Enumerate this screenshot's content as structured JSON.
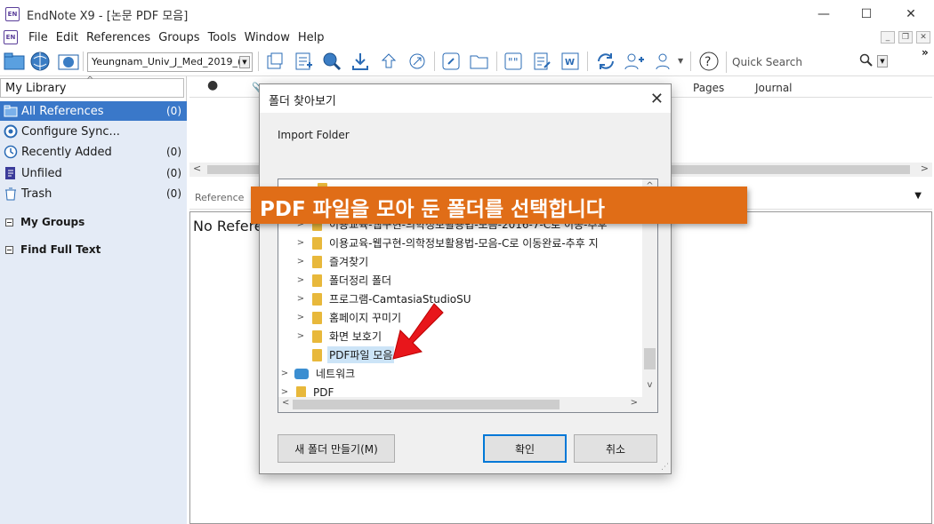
{
  "window": {
    "title": "EndNote X9 - [논문 PDF 모음]",
    "app_icon_text": "EN",
    "minimize": "—",
    "maximize": "☐",
    "close": "✕"
  },
  "menu": [
    "File",
    "Edit",
    "References",
    "Groups",
    "Tools",
    "Window",
    "Help"
  ],
  "toolbar": {
    "style_value": "Yeungnam_Univ_J_Med_2019_(",
    "quick_search_placeholder": "Quick Search"
  },
  "library": {
    "header": "My Library",
    "items": [
      {
        "label": "All References",
        "count": "(0)"
      },
      {
        "label": "Configure Sync...",
        "count": ""
      },
      {
        "label": "Recently Added",
        "count": "(0)"
      },
      {
        "label": "Unfiled",
        "count": "(0)"
      },
      {
        "label": "Trash",
        "count": "(0)"
      }
    ],
    "groups": [
      "My Groups",
      "Find Full Text"
    ]
  },
  "list_columns": {
    "pages": "Pages",
    "journal": "Journal"
  },
  "ref_tab": "Reference",
  "preview_text": "No Refere",
  "dialog": {
    "title": "폴더 찾아보기",
    "description": "Import Folder",
    "tree": [
      {
        "label": "이용교육-웹구현-의학정보활용법-모음-2016-7-C로 이동-추후",
        "type": "folder"
      },
      {
        "label": "이용교육-웹구현-의학정보활용법-모음-C로 이동완료-추후 지",
        "type": "folder"
      },
      {
        "label": "즐겨찾기",
        "type": "folder"
      },
      {
        "label": "폴더정리 폴더",
        "type": "folder"
      },
      {
        "label": "프로그램-CamtasiaStudioSU",
        "type": "folder"
      },
      {
        "label": "홈페이지 꾸미기",
        "type": "folder"
      },
      {
        "label": "화면 보호기",
        "type": "folder"
      },
      {
        "label": "PDF파일 모음",
        "type": "folder-selected"
      },
      {
        "label": "네트워크",
        "type": "network"
      },
      {
        "label": "PDF",
        "type": "folder-root"
      }
    ],
    "new_folder_button": "새 폴더 만들기(M)",
    "ok_button": "확인",
    "cancel_button": "취소"
  },
  "annotation": {
    "banner_text": "PDF 파일을 모아 둔 폴더를 선택합니다"
  },
  "colors": {
    "selection_blue": "#3a78c9",
    "sidebar_bg": "#e4ebf6",
    "banner_orange": "#e06d17",
    "arrow_red": "#e8161b"
  }
}
